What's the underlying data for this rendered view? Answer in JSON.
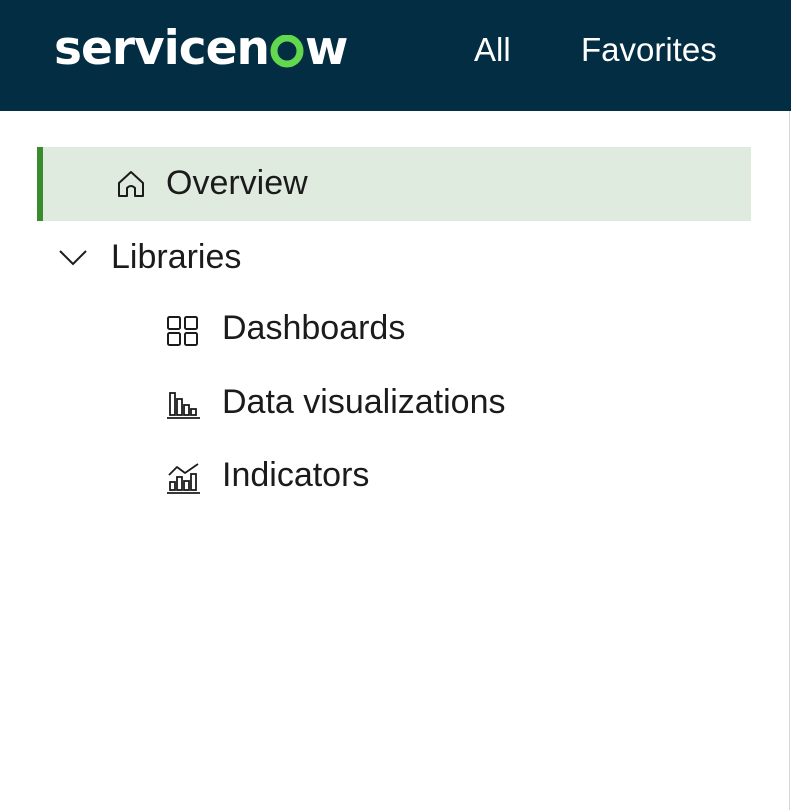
{
  "header": {
    "logo_text_left": "servicen",
    "logo_text_right": "w",
    "nav": [
      {
        "label": "All"
      },
      {
        "label": "Favorites"
      }
    ]
  },
  "sidebar": {
    "overview": {
      "label": "Overview",
      "icon": "home-icon",
      "selected": true
    },
    "libraries": {
      "label": "Libraries",
      "icon": "chevron-down-icon",
      "expanded": true,
      "items": [
        {
          "label": "Dashboards",
          "icon": "grid-icon"
        },
        {
          "label": "Data visualizations",
          "icon": "bar-chart-icon"
        },
        {
          "label": "Indicators",
          "icon": "trend-chart-icon"
        }
      ]
    }
  },
  "colors": {
    "header_bg": "#032d42",
    "logo_accent": "#62d84e",
    "selected_bg": "#e0ebe0",
    "selected_border": "#3a8a2e",
    "text": "#1b1b1b"
  }
}
